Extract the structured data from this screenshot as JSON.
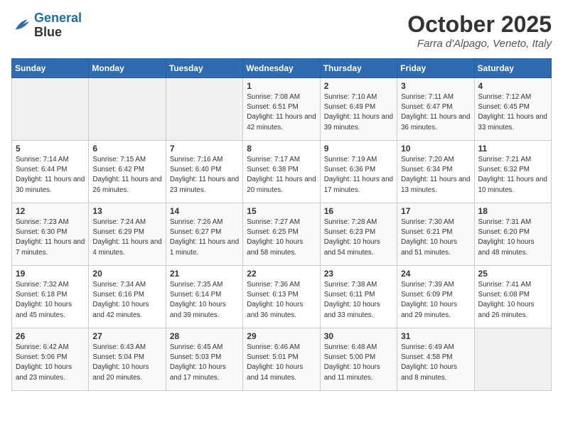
{
  "header": {
    "logo_line1": "General",
    "logo_line2": "Blue",
    "month": "October 2025",
    "location": "Farra d'Alpago, Veneto, Italy"
  },
  "weekdays": [
    "Sunday",
    "Monday",
    "Tuesday",
    "Wednesday",
    "Thursday",
    "Friday",
    "Saturday"
  ],
  "weeks": [
    [
      {
        "day": "",
        "empty": true
      },
      {
        "day": "",
        "empty": true
      },
      {
        "day": "",
        "empty": true
      },
      {
        "day": "1",
        "sunrise": "7:08 AM",
        "sunset": "6:51 PM",
        "daylight": "11 hours and 42 minutes."
      },
      {
        "day": "2",
        "sunrise": "7:10 AM",
        "sunset": "6:49 PM",
        "daylight": "11 hours and 39 minutes."
      },
      {
        "day": "3",
        "sunrise": "7:11 AM",
        "sunset": "6:47 PM",
        "daylight": "11 hours and 36 minutes."
      },
      {
        "day": "4",
        "sunrise": "7:12 AM",
        "sunset": "6:45 PM",
        "daylight": "11 hours and 33 minutes."
      }
    ],
    [
      {
        "day": "5",
        "sunrise": "7:14 AM",
        "sunset": "6:44 PM",
        "daylight": "11 hours and 30 minutes."
      },
      {
        "day": "6",
        "sunrise": "7:15 AM",
        "sunset": "6:42 PM",
        "daylight": "11 hours and 26 minutes."
      },
      {
        "day": "7",
        "sunrise": "7:16 AM",
        "sunset": "6:40 PM",
        "daylight": "11 hours and 23 minutes."
      },
      {
        "day": "8",
        "sunrise": "7:17 AM",
        "sunset": "6:38 PM",
        "daylight": "11 hours and 20 minutes."
      },
      {
        "day": "9",
        "sunrise": "7:19 AM",
        "sunset": "6:36 PM",
        "daylight": "11 hours and 17 minutes."
      },
      {
        "day": "10",
        "sunrise": "7:20 AM",
        "sunset": "6:34 PM",
        "daylight": "11 hours and 13 minutes."
      },
      {
        "day": "11",
        "sunrise": "7:21 AM",
        "sunset": "6:32 PM",
        "daylight": "11 hours and 10 minutes."
      }
    ],
    [
      {
        "day": "12",
        "sunrise": "7:23 AM",
        "sunset": "6:30 PM",
        "daylight": "11 hours and 7 minutes."
      },
      {
        "day": "13",
        "sunrise": "7:24 AM",
        "sunset": "6:29 PM",
        "daylight": "11 hours and 4 minutes."
      },
      {
        "day": "14",
        "sunrise": "7:26 AM",
        "sunset": "6:27 PM",
        "daylight": "11 hours and 1 minute."
      },
      {
        "day": "15",
        "sunrise": "7:27 AM",
        "sunset": "6:25 PM",
        "daylight": "10 hours and 58 minutes."
      },
      {
        "day": "16",
        "sunrise": "7:28 AM",
        "sunset": "6:23 PM",
        "daylight": "10 hours and 54 minutes."
      },
      {
        "day": "17",
        "sunrise": "7:30 AM",
        "sunset": "6:21 PM",
        "daylight": "10 hours and 51 minutes."
      },
      {
        "day": "18",
        "sunrise": "7:31 AM",
        "sunset": "6:20 PM",
        "daylight": "10 hours and 48 minutes."
      }
    ],
    [
      {
        "day": "19",
        "sunrise": "7:32 AM",
        "sunset": "6:18 PM",
        "daylight": "10 hours and 45 minutes."
      },
      {
        "day": "20",
        "sunrise": "7:34 AM",
        "sunset": "6:16 PM",
        "daylight": "10 hours and 42 minutes."
      },
      {
        "day": "21",
        "sunrise": "7:35 AM",
        "sunset": "6:14 PM",
        "daylight": "10 hours and 39 minutes."
      },
      {
        "day": "22",
        "sunrise": "7:36 AM",
        "sunset": "6:13 PM",
        "daylight": "10 hours and 36 minutes."
      },
      {
        "day": "23",
        "sunrise": "7:38 AM",
        "sunset": "6:11 PM",
        "daylight": "10 hours and 33 minutes."
      },
      {
        "day": "24",
        "sunrise": "7:39 AM",
        "sunset": "6:09 PM",
        "daylight": "10 hours and 29 minutes."
      },
      {
        "day": "25",
        "sunrise": "7:41 AM",
        "sunset": "6:08 PM",
        "daylight": "10 hours and 26 minutes."
      }
    ],
    [
      {
        "day": "26",
        "sunrise": "6:42 AM",
        "sunset": "5:06 PM",
        "daylight": "10 hours and 23 minutes."
      },
      {
        "day": "27",
        "sunrise": "6:43 AM",
        "sunset": "5:04 PM",
        "daylight": "10 hours and 20 minutes."
      },
      {
        "day": "28",
        "sunrise": "6:45 AM",
        "sunset": "5:03 PM",
        "daylight": "10 hours and 17 minutes."
      },
      {
        "day": "29",
        "sunrise": "6:46 AM",
        "sunset": "5:01 PM",
        "daylight": "10 hours and 14 minutes."
      },
      {
        "day": "30",
        "sunrise": "6:48 AM",
        "sunset": "5:00 PM",
        "daylight": "10 hours and 11 minutes."
      },
      {
        "day": "31",
        "sunrise": "6:49 AM",
        "sunset": "4:58 PM",
        "daylight": "10 hours and 8 minutes."
      },
      {
        "day": "",
        "empty": true
      }
    ]
  ]
}
